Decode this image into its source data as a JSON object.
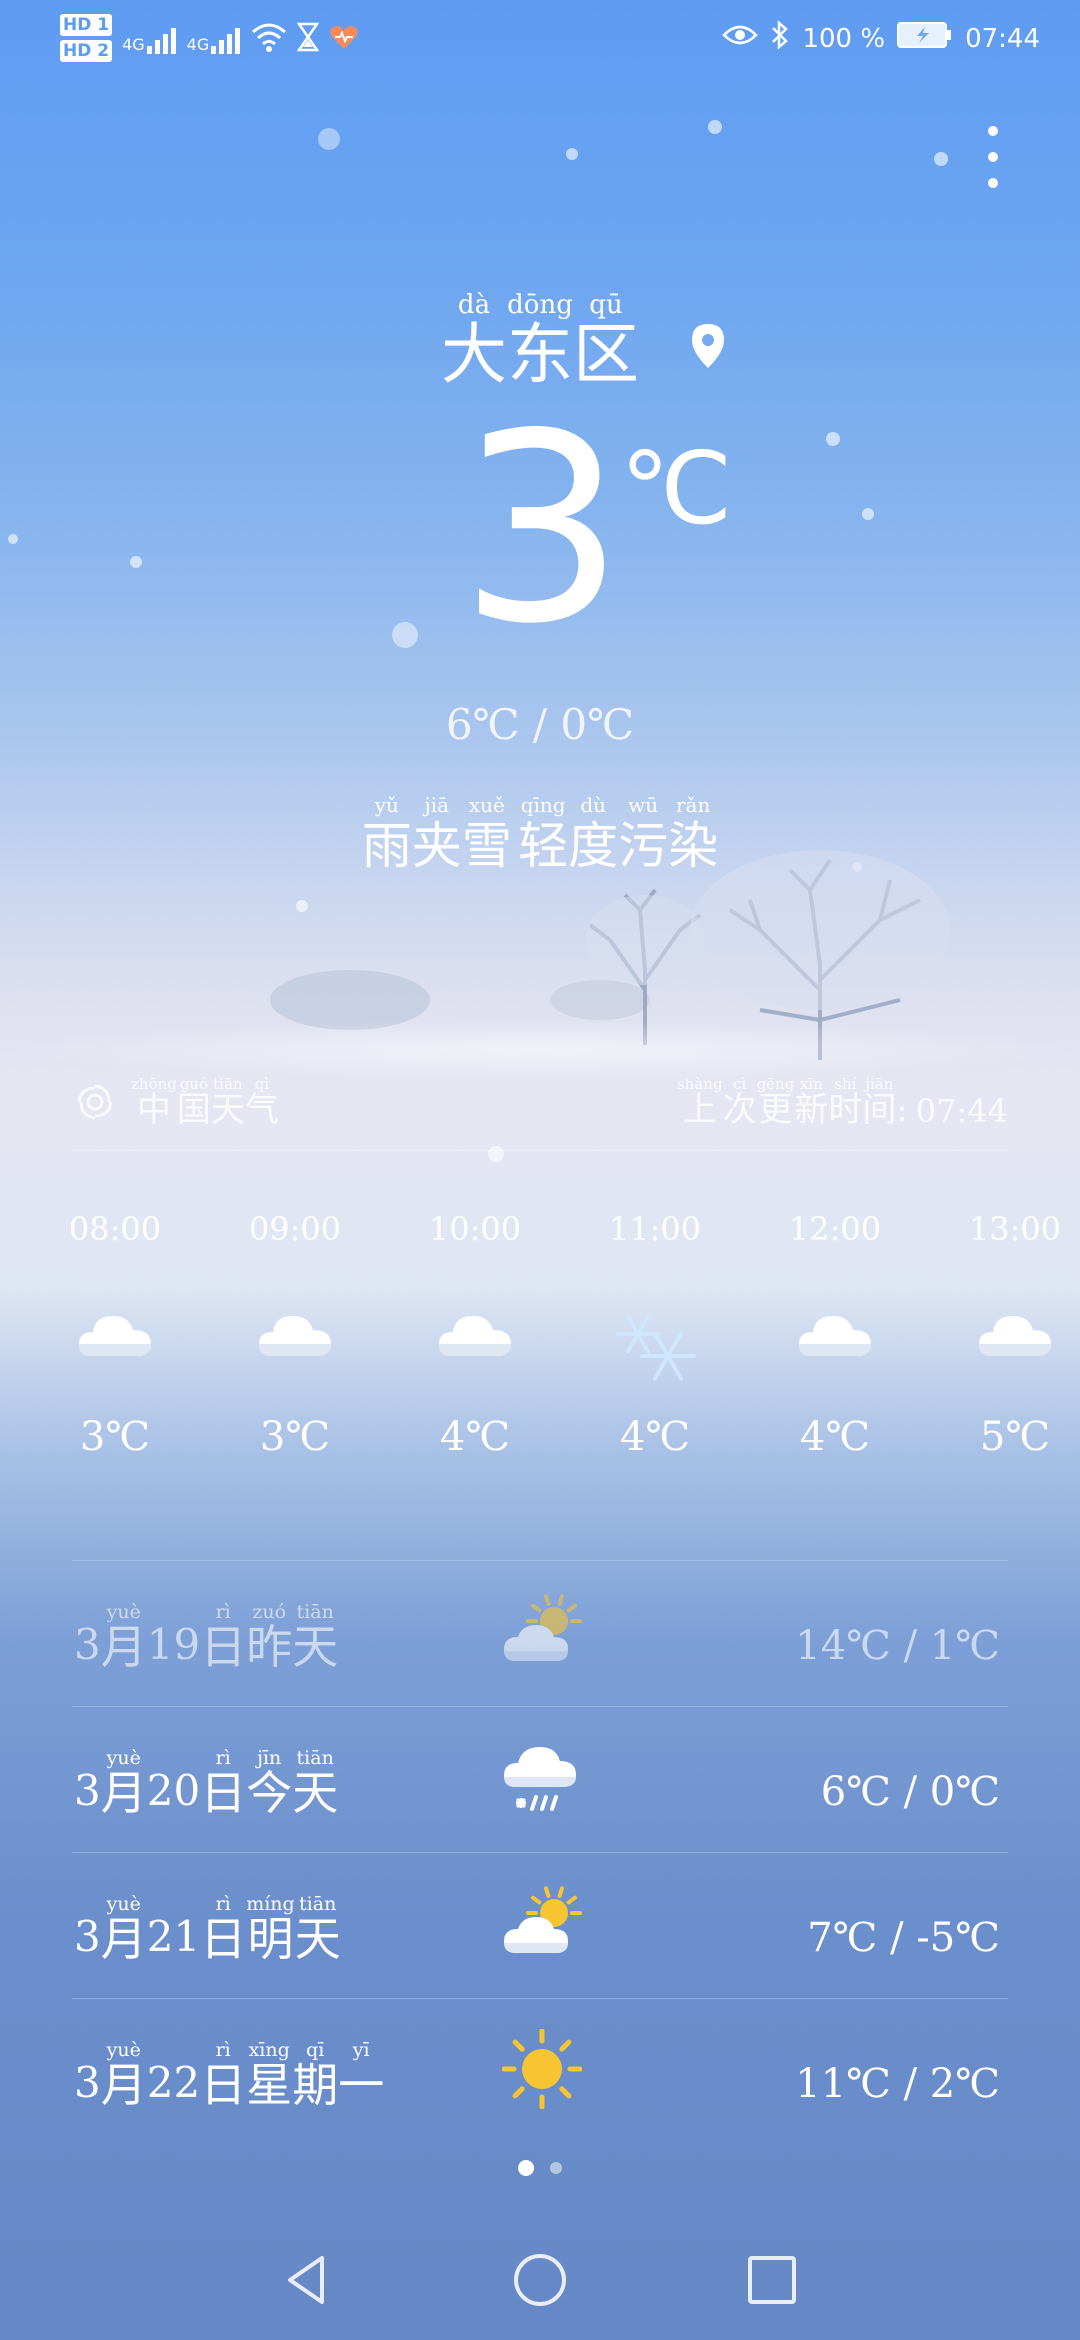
{
  "status_bar": {
    "hd1": "HD 1",
    "hd2": "HD 2",
    "signal1": "4G",
    "signal2": "4G",
    "battery_pct": "100 %",
    "time": "07:44"
  },
  "location": {
    "name": [
      {
        "py": "dà",
        "hz": "大"
      },
      {
        "py": "dōng",
        "hz": "东"
      },
      {
        "py": "qū",
        "hz": "区"
      }
    ]
  },
  "current": {
    "temp": "3",
    "unit": "℃",
    "range": "6℃ / 0℃",
    "condition": [
      {
        "py": "yǔ",
        "hz": "雨"
      },
      {
        "py": "jiā",
        "hz": "夹"
      },
      {
        "py": "xuě",
        "hz": "雪"
      },
      {
        "py": "",
        "hz": " "
      },
      {
        "py": "qīng",
        "hz": "轻"
      },
      {
        "py": "dù",
        "hz": "度"
      },
      {
        "py": "wū",
        "hz": "污"
      },
      {
        "py": "rǎn",
        "hz": "染"
      }
    ]
  },
  "source": {
    "name": [
      {
        "py": "zhōng",
        "hz": "中"
      },
      {
        "py": "guó",
        "hz": "国"
      },
      {
        "py": "tiān",
        "hz": "天"
      },
      {
        "py": "qì",
        "hz": "气"
      }
    ],
    "updated_label": [
      {
        "py": "shàng",
        "hz": "上"
      },
      {
        "py": "cì",
        "hz": "次"
      },
      {
        "py": "gēng",
        "hz": "更"
      },
      {
        "py": "xīn",
        "hz": "新"
      },
      {
        "py": "shí",
        "hz": "时"
      },
      {
        "py": "jiān",
        "hz": "间"
      },
      {
        "py": "",
        "hz": ":"
      }
    ],
    "updated_time": "07:44"
  },
  "hourly": [
    {
      "time": "08:00",
      "icon": "cloud-icon",
      "temp": "3℃"
    },
    {
      "time": "09:00",
      "icon": "cloud-icon",
      "temp": "3℃"
    },
    {
      "time": "10:00",
      "icon": "cloud-icon",
      "temp": "4℃"
    },
    {
      "time": "11:00",
      "icon": "snowflake-icon",
      "temp": "4℃"
    },
    {
      "time": "12:00",
      "icon": "cloud-icon",
      "temp": "4℃"
    },
    {
      "time": "13:00",
      "icon": "cloud-icon",
      "temp": "5℃"
    }
  ],
  "daily": [
    {
      "month": "3",
      "month_py": "yuè",
      "month_hz": "月",
      "day": "19",
      "day_py": "rì",
      "day_hz": "日",
      "label": [
        {
          "py": "zuó",
          "hz": "昨"
        },
        {
          "py": "tiān",
          "hz": "天"
        }
      ],
      "icon": "partly-cloudy-icon",
      "temps": "14℃  /  1℃",
      "past": true
    },
    {
      "month": "3",
      "month_py": "yuè",
      "month_hz": "月",
      "day": "20",
      "day_py": "rì",
      "day_hz": "日",
      "label": [
        {
          "py": "jīn",
          "hz": "今"
        },
        {
          "py": "tiān",
          "hz": "天"
        }
      ],
      "icon": "sleet-icon",
      "temps": "6℃  /  0℃",
      "past": false
    },
    {
      "month": "3",
      "month_py": "yuè",
      "month_hz": "月",
      "day": "21",
      "day_py": "rì",
      "day_hz": "日",
      "label": [
        {
          "py": "míng",
          "hz": "明"
        },
        {
          "py": "tiān",
          "hz": "天"
        }
      ],
      "icon": "partly-cloudy-icon",
      "temps": "7℃  /  -5℃",
      "past": false
    },
    {
      "month": "3",
      "month_py": "yuè",
      "month_hz": "月",
      "day": "22",
      "day_py": "rì",
      "day_hz": "日",
      "label": [
        {
          "py": "xīng",
          "hz": "星"
        },
        {
          "py": "qī",
          "hz": "期"
        },
        {
          "py": "yī",
          "hz": "一"
        }
      ],
      "icon": "sun-icon",
      "temps": "11℃  /  2℃",
      "past": false
    }
  ],
  "colors": {
    "sun": "#f7c531",
    "cloud": "#ffffff",
    "snow": "#cfe6ff"
  }
}
